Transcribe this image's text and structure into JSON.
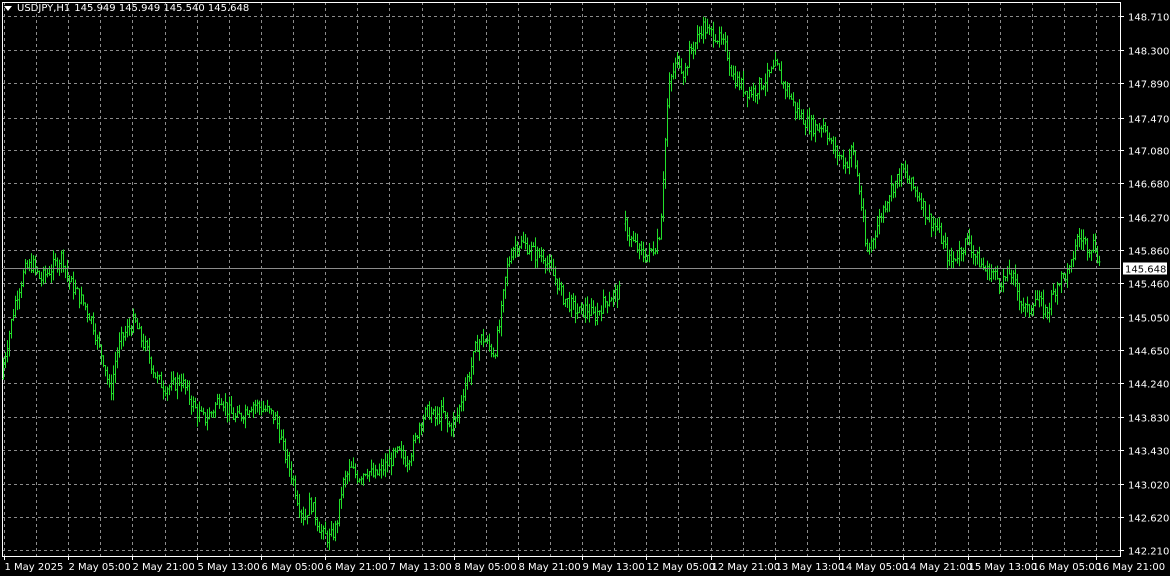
{
  "header": {
    "symbol": "USDJPY,H1",
    "ohlc": "145.949 145.949 145.540 145.648"
  },
  "current_price_label": "145.648",
  "chart_data": {
    "type": "candlestick",
    "symbol": "USDJPY",
    "timeframe": "H1",
    "grid": true,
    "background_color": "#000000",
    "grid_color": "#8c8c8c",
    "bar_color": "#22e02a",
    "axis_text_color": "#ffffff",
    "current_price_line_color": "#8c8c8c",
    "ylim": [
      142.14,
      148.88
    ],
    "current_price": 145.648,
    "y_ticks": [
      "148.710",
      "148.300",
      "147.890",
      "147.470",
      "147.080",
      "146.680",
      "146.270",
      "145.860",
      "145.460",
      "145.050",
      "144.650",
      "144.240",
      "143.830",
      "143.430",
      "143.020",
      "142.620",
      "142.210"
    ],
    "x_ticks": [
      "1 May 2025",
      "2 May 05:00",
      "2 May 21:00",
      "5 May 13:00",
      "6 May 05:00",
      "6 May 21:00",
      "7 May 13:00",
      "8 May 05:00",
      "8 May 21:00",
      "9 May 13:00",
      "12 May 05:00",
      "12 May 21:00",
      "13 May 13:00",
      "14 May 05:00",
      "14 May 21:00",
      "15 May 13:00",
      "16 May 05:00",
      "16 May 21:00"
    ],
    "close_path": [
      [
        0,
        144.3
      ],
      [
        8,
        144.8
      ],
      [
        16,
        145.3
      ],
      [
        24,
        145.6
      ],
      [
        32,
        145.7
      ],
      [
        40,
        145.5
      ],
      [
        48,
        145.6
      ],
      [
        56,
        145.7
      ],
      [
        62,
        145.8
      ],
      [
        68,
        145.5
      ],
      [
        76,
        145.35
      ],
      [
        84,
        145.2
      ],
      [
        92,
        145.0
      ],
      [
        98,
        144.7
      ],
      [
        104,
        144.5
      ],
      [
        110,
        144.1
      ],
      [
        116,
        144.6
      ],
      [
        122,
        144.8
      ],
      [
        128,
        144.9
      ],
      [
        134,
        145.0
      ],
      [
        140,
        144.8
      ],
      [
        148,
        144.6
      ],
      [
        156,
        144.3
      ],
      [
        164,
        144.2
      ],
      [
        172,
        144.2
      ],
      [
        180,
        144.3
      ],
      [
        188,
        144.1
      ],
      [
        196,
        143.9
      ],
      [
        204,
        143.8
      ],
      [
        212,
        143.9
      ],
      [
        220,
        144.1
      ],
      [
        228,
        143.9
      ],
      [
        236,
        143.8
      ],
      [
        244,
        143.9
      ],
      [
        252,
        144.0
      ],
      [
        260,
        143.95
      ],
      [
        268,
        143.9
      ],
      [
        276,
        143.8
      ],
      [
        284,
        143.4
      ],
      [
        292,
        143.1
      ],
      [
        298,
        142.8
      ],
      [
        304,
        142.6
      ],
      [
        310,
        142.8
      ],
      [
        316,
        142.6
      ],
      [
        322,
        142.4
      ],
      [
        330,
        142.35
      ],
      [
        336,
        142.5
      ],
      [
        342,
        143.0
      ],
      [
        350,
        143.2
      ],
      [
        358,
        143.1
      ],
      [
        366,
        143.2
      ],
      [
        374,
        143.1
      ],
      [
        382,
        143.2
      ],
      [
        390,
        143.3
      ],
      [
        398,
        143.4
      ],
      [
        406,
        143.3
      ],
      [
        414,
        143.5
      ],
      [
        420,
        143.8
      ],
      [
        428,
        143.9
      ],
      [
        436,
        143.8
      ],
      [
        442,
        143.9
      ],
      [
        448,
        143.7
      ],
      [
        456,
        143.8
      ],
      [
        464,
        144.2
      ],
      [
        470,
        144.4
      ],
      [
        476,
        144.7
      ],
      [
        482,
        144.8
      ],
      [
        488,
        144.7
      ],
      [
        494,
        144.6
      ],
      [
        500,
        145.0
      ],
      [
        506,
        145.6
      ],
      [
        512,
        145.9
      ],
      [
        520,
        145.95
      ],
      [
        528,
        145.9
      ],
      [
        536,
        145.8
      ],
      [
        544,
        145.8
      ],
      [
        550,
        145.6
      ],
      [
        556,
        145.5
      ],
      [
        562,
        145.3
      ],
      [
        570,
        145.2
      ],
      [
        578,
        145.1
      ],
      [
        586,
        145.15
      ],
      [
        594,
        145.05
      ],
      [
        602,
        145.2
      ],
      [
        610,
        145.3
      ],
      [
        620,
        145.35
      ],
      [
        624,
        146.2
      ],
      [
        630,
        146.0
      ],
      [
        636,
        145.9
      ],
      [
        642,
        145.8
      ],
      [
        648,
        145.8
      ],
      [
        654,
        145.9
      ],
      [
        660,
        146.1
      ],
      [
        664,
        147.0
      ],
      [
        668,
        147.8
      ],
      [
        672,
        148.0
      ],
      [
        678,
        148.2
      ],
      [
        684,
        148.0
      ],
      [
        690,
        148.3
      ],
      [
        696,
        148.4
      ],
      [
        702,
        148.6
      ],
      [
        708,
        148.5
      ],
      [
        714,
        148.5
      ],
      [
        720,
        148.4
      ],
      [
        726,
        148.3
      ],
      [
        732,
        148.0
      ],
      [
        738,
        147.9
      ],
      [
        746,
        147.8
      ],
      [
        754,
        147.8
      ],
      [
        762,
        147.9
      ],
      [
        770,
        148.0
      ],
      [
        776,
        148.1
      ],
      [
        782,
        147.9
      ],
      [
        788,
        147.8
      ],
      [
        794,
        147.6
      ],
      [
        800,
        147.5
      ],
      [
        808,
        147.4
      ],
      [
        816,
        147.35
      ],
      [
        824,
        147.4
      ],
      [
        832,
        147.1
      ],
      [
        840,
        147.0
      ],
      [
        846,
        146.9
      ],
      [
        852,
        147.1
      ],
      [
        858,
        146.7
      ],
      [
        862,
        146.3
      ],
      [
        866,
        145.8
      ],
      [
        872,
        146.0
      ],
      [
        878,
        146.2
      ],
      [
        884,
        146.4
      ],
      [
        890,
        146.6
      ],
      [
        896,
        146.7
      ],
      [
        902,
        146.85
      ],
      [
        908,
        146.7
      ],
      [
        914,
        146.6
      ],
      [
        920,
        146.5
      ],
      [
        926,
        146.3
      ],
      [
        932,
        146.2
      ],
      [
        938,
        146.1
      ],
      [
        944,
        145.9
      ],
      [
        950,
        145.7
      ],
      [
        956,
        145.8
      ],
      [
        962,
        145.9
      ],
      [
        968,
        146.0
      ],
      [
        974,
        145.8
      ],
      [
        980,
        145.7
      ],
      [
        986,
        145.6
      ],
      [
        992,
        145.6
      ],
      [
        998,
        145.5
      ],
      [
        1004,
        145.5
      ],
      [
        1010,
        145.6
      ],
      [
        1016,
        145.4
      ],
      [
        1022,
        145.2
      ],
      [
        1028,
        145.1
      ],
      [
        1034,
        145.3
      ],
      [
        1040,
        145.2
      ],
      [
        1046,
        145.1
      ],
      [
        1052,
        145.3
      ],
      [
        1058,
        145.5
      ],
      [
        1064,
        145.55
      ],
      [
        1070,
        145.6
      ],
      [
        1076,
        146.0
      ],
      [
        1082,
        146.0
      ],
      [
        1088,
        145.9
      ],
      [
        1094,
        145.95
      ],
      [
        1100,
        145.648
      ]
    ]
  }
}
